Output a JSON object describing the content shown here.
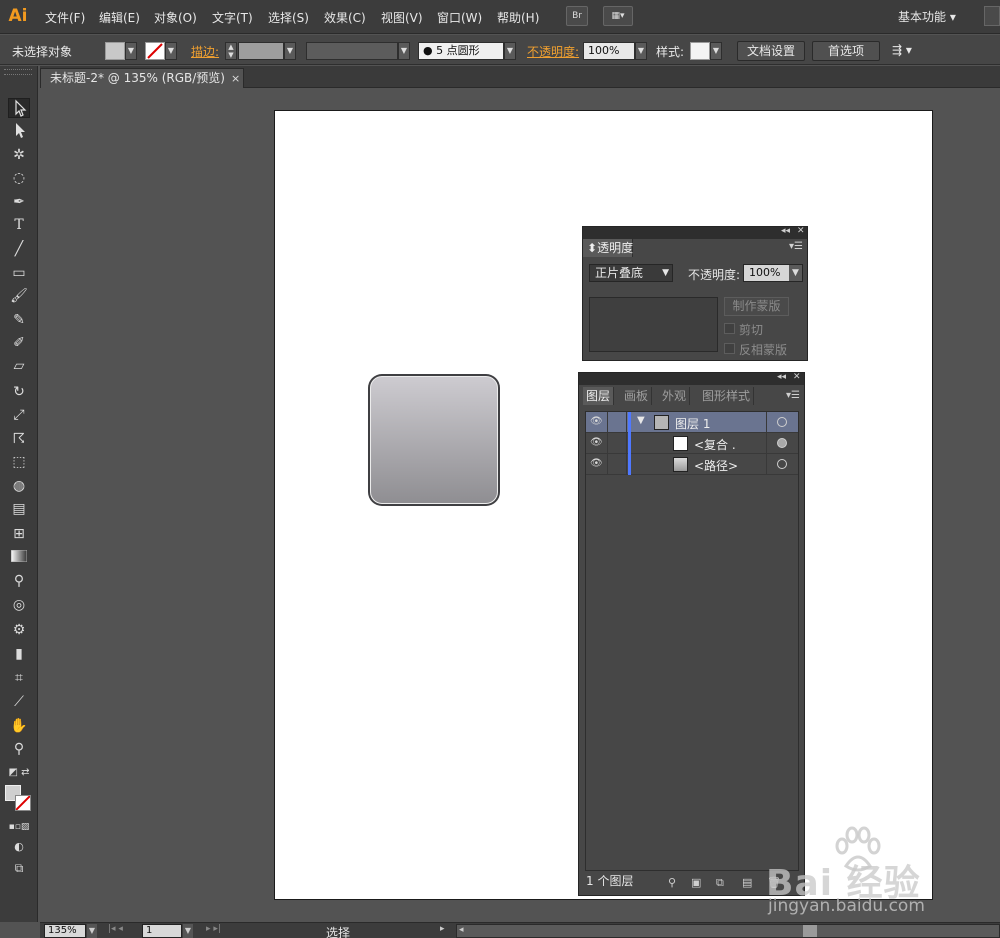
{
  "app": {
    "logo": "Ai",
    "accent_color": "#f29a1f"
  },
  "menu": {
    "items": [
      "文件(F)",
      "编辑(E)",
      "对象(O)",
      "文字(T)",
      "选择(S)",
      "效果(C)",
      "视图(V)",
      "窗口(W)",
      "帮助(H)"
    ],
    "bridge_label": "Br",
    "arrange_label": "▦▾",
    "workspace": "基本功能 ▾"
  },
  "control_bar": {
    "selection_status": "未选择对象",
    "stroke_label": "描边:",
    "brush_value": "● 5 点圆形",
    "opacity_label": "不透明度:",
    "opacity_value": "100%",
    "style_label": "样式:",
    "doc_setup_button": "文档设置",
    "preferences_button": "首选项"
  },
  "document_tab": {
    "title": "未标题-2* @ 135% (RGB/预览)",
    "close": "×"
  },
  "toolbar": {
    "tools": [
      "selection-tool",
      "direct-selection-tool",
      "magic-wand-tool",
      "lasso-tool",
      "pen-tool",
      "type-tool",
      "line-tool",
      "rectangle-tool",
      "paintbrush-tool",
      "pencil-tool",
      "blob-brush-tool",
      "eraser-tool",
      "rotate-tool",
      "scale-tool",
      "warp-tool",
      "free-transform-tool",
      "shape-builder-tool",
      "perspective-grid-tool",
      "mesh-tool",
      "gradient-tool",
      "eyedropper-tool",
      "blend-tool",
      "symbol-sprayer-tool",
      "column-graph-tool",
      "artboard-tool",
      "slice-tool",
      "hand-tool",
      "zoom-tool"
    ]
  },
  "transparency_panel": {
    "tab": "透明度",
    "blend_mode": "正片叠底",
    "opacity_label": "不透明度:",
    "opacity_value": "100%",
    "make_mask_button": "制作蒙版",
    "clip_label": "剪切",
    "invert_mask_label": "反相蒙版"
  },
  "layers_panel": {
    "tabs": [
      "图层",
      "画板",
      "外观",
      "图形样式"
    ],
    "rows": [
      {
        "name": "图层 1",
        "expanded": true,
        "selected": true
      },
      {
        "name": "<复合 .",
        "selected": false
      },
      {
        "name": "<路径>",
        "selected": false
      }
    ],
    "footer_count": "1 个图层"
  },
  "status_bar": {
    "zoom": "135%",
    "artboard_number": "1",
    "current_tool": "选择"
  },
  "watermark": {
    "brand": "Bai 经验",
    "url": "jingyan.baidu.com"
  }
}
